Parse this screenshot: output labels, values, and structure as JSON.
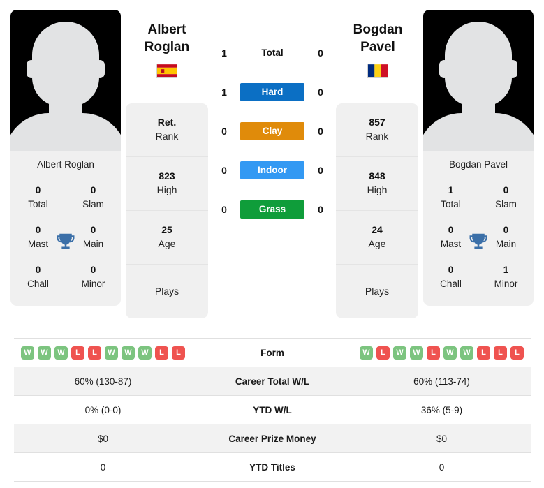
{
  "players": {
    "left": {
      "first_name": "Albert",
      "last_name": "Roglan",
      "full_name": "Albert Roglan",
      "country": "Spain",
      "flag_icon": "flag-spain-icon",
      "avatar_icon": "player-avatar-placeholder-icon",
      "titles": {
        "total": "0",
        "slam": "0",
        "mast": "0",
        "main": "0",
        "chall": "0",
        "minor": "0"
      },
      "stats": {
        "rank_value": "Ret.",
        "rank_label": "Rank",
        "high_value": "823",
        "high_label": "High",
        "age_value": "25",
        "age_label": "Age",
        "plays_value": "",
        "plays_label": "Plays"
      },
      "surface_wins": {
        "total": "1",
        "hard": "1",
        "clay": "0",
        "indoor": "0",
        "grass": "0"
      },
      "form": [
        "W",
        "W",
        "W",
        "L",
        "L",
        "W",
        "W",
        "W",
        "L",
        "L"
      ],
      "career_total_wl": "60% (130-87)",
      "ytd_wl": "0% (0-0)",
      "career_prize_money": "$0",
      "ytd_titles": "0"
    },
    "right": {
      "first_name": "Bogdan",
      "last_name": "Pavel",
      "full_name": "Bogdan Pavel",
      "country": "Romania",
      "flag_icon": "flag-romania-icon",
      "avatar_icon": "player-avatar-placeholder-icon",
      "titles": {
        "total": "1",
        "slam": "0",
        "mast": "0",
        "main": "0",
        "chall": "0",
        "minor": "1"
      },
      "stats": {
        "rank_value": "857",
        "rank_label": "Rank",
        "high_value": "848",
        "high_label": "High",
        "age_value": "24",
        "age_label": "Age",
        "plays_value": "",
        "plays_label": "Plays"
      },
      "surface_wins": {
        "total": "0",
        "hard": "0",
        "clay": "0",
        "indoor": "0",
        "grass": "0"
      },
      "form": [
        "W",
        "L",
        "W",
        "W",
        "L",
        "W",
        "W",
        "L",
        "L",
        "L"
      ],
      "career_total_wl": "60% (113-74)",
      "ytd_wl": "36% (5-9)",
      "career_prize_money": "$0",
      "ytd_titles": "0"
    }
  },
  "title_labels": {
    "total": "Total",
    "slam": "Slam",
    "mast": "Mast",
    "main": "Main",
    "chall": "Chall",
    "minor": "Minor",
    "trophy_icon": "trophy-icon"
  },
  "surfaces": [
    {
      "key": "total",
      "label": "Total",
      "color": "transparent",
      "text_color": "#111111"
    },
    {
      "key": "hard",
      "label": "Hard",
      "color": "#0b6fc4",
      "text_color": "#ffffff"
    },
    {
      "key": "clay",
      "label": "Clay",
      "color": "#e08b0a",
      "text_color": "#ffffff"
    },
    {
      "key": "indoor",
      "label": "Indoor",
      "color": "#3399f3",
      "text_color": "#ffffff"
    },
    {
      "key": "grass",
      "label": "Grass",
      "color": "#0f9d3a",
      "text_color": "#ffffff"
    }
  ],
  "table_rows": [
    {
      "label": "Form",
      "key": "form"
    },
    {
      "label": "Career Total W/L",
      "key": "career_total_wl"
    },
    {
      "label": "YTD W/L",
      "key": "ytd_wl"
    },
    {
      "label": "Career Prize Money",
      "key": "career_prize_money"
    },
    {
      "label": "YTD Titles",
      "key": "ytd_titles"
    }
  ],
  "colors": {
    "form_win": "#7cc47f",
    "form_loss": "#ef5350",
    "card_bg": "#f0f0f0",
    "trophy": "#3b6fa8"
  }
}
